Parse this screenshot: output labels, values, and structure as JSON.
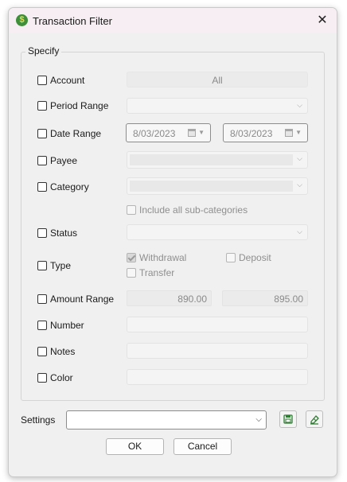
{
  "window": {
    "title": "Transaction Filter",
    "app_icon_glyph": "$",
    "close_glyph": "✕"
  },
  "group": {
    "legend": "Specify"
  },
  "fields": {
    "account": {
      "label": "Account",
      "value": "All"
    },
    "period_range": {
      "label": "Period Range"
    },
    "date_range": {
      "label": "Date Range",
      "from": "8/03/2023",
      "to": "8/03/2023"
    },
    "payee": {
      "label": "Payee"
    },
    "category": {
      "label": "Category",
      "include_sub": "Include all sub-categories"
    },
    "status": {
      "label": "Status"
    },
    "type": {
      "label": "Type",
      "withdrawal": "Withdrawal",
      "deposit": "Deposit",
      "transfer": "Transfer"
    },
    "amount_range": {
      "label": "Amount Range",
      "min": "890.00",
      "max": "895.00"
    },
    "number": {
      "label": "Number"
    },
    "notes": {
      "label": "Notes"
    },
    "color": {
      "label": "Color"
    }
  },
  "settings": {
    "label": "Settings",
    "value": ""
  },
  "buttons": {
    "ok": "OK",
    "cancel": "Cancel"
  },
  "icons": {
    "save": "save-icon",
    "clear": "eraser-icon",
    "calendar": "calendar-icon",
    "dropdown": "chevron-down-icon"
  },
  "colors": {
    "titlebar": "#f7eef3",
    "app_icon": "#3f8f3a",
    "icon_green": "#2e7d32"
  }
}
